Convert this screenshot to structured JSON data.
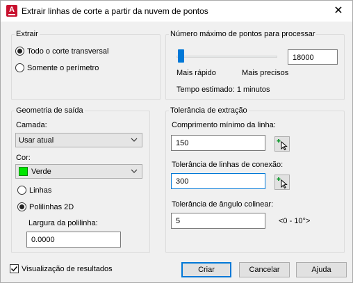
{
  "window": {
    "title": "Extrair linhas de corte a partir da nuvem de pontos",
    "close_glyph": "✕",
    "app_icon_letter": "A"
  },
  "extrair": {
    "group_title": "Extrair",
    "option_todo": "Todo o corte transversal",
    "option_perimetro": "Somente o perímetro",
    "selected": "Todo o corte transversal"
  },
  "pontos": {
    "group_title": "Número máximo de pontos para processar",
    "value": "18000",
    "slider_level_fraction": 0.03,
    "label_fast": "Mais rápido",
    "label_precise": "Mais precisos",
    "estimate": "Tempo estimado: 1 minutos"
  },
  "geometria": {
    "group_title": "Geometria de saída",
    "camada_label": "Camada:",
    "camada_value": "Usar atual",
    "cor_label": "Cor:",
    "cor_value": "Verde",
    "cor_swatch": "#00e600",
    "option_linhas": "Linhas",
    "option_polilinhas": "Polilinhas 2D",
    "selected": "Polilinhas 2D",
    "largura_label": "Largura da polilinha:",
    "largura_value": "0.0000"
  },
  "tolerancia": {
    "group_title": "Tolerância de extração",
    "comprimento_label": "Comprimento mínimo da linha:",
    "comprimento_value": "150",
    "conexao_label": "Tolerância de linhas de conexão:",
    "conexao_value": "300",
    "angulo_label": "Tolerância de ângulo colinear:",
    "angulo_value": "5",
    "angulo_range": "<0 - 10°>"
  },
  "footer": {
    "preview_label": "Visualização de resultados",
    "preview_checked": true,
    "criar": "Criar",
    "cancelar": "Cancelar",
    "ajuda": "Ajuda"
  },
  "colors": {
    "accent": "#0078d7",
    "app_icon": "#c8102e",
    "pick_plus": "#1e9e3a"
  }
}
